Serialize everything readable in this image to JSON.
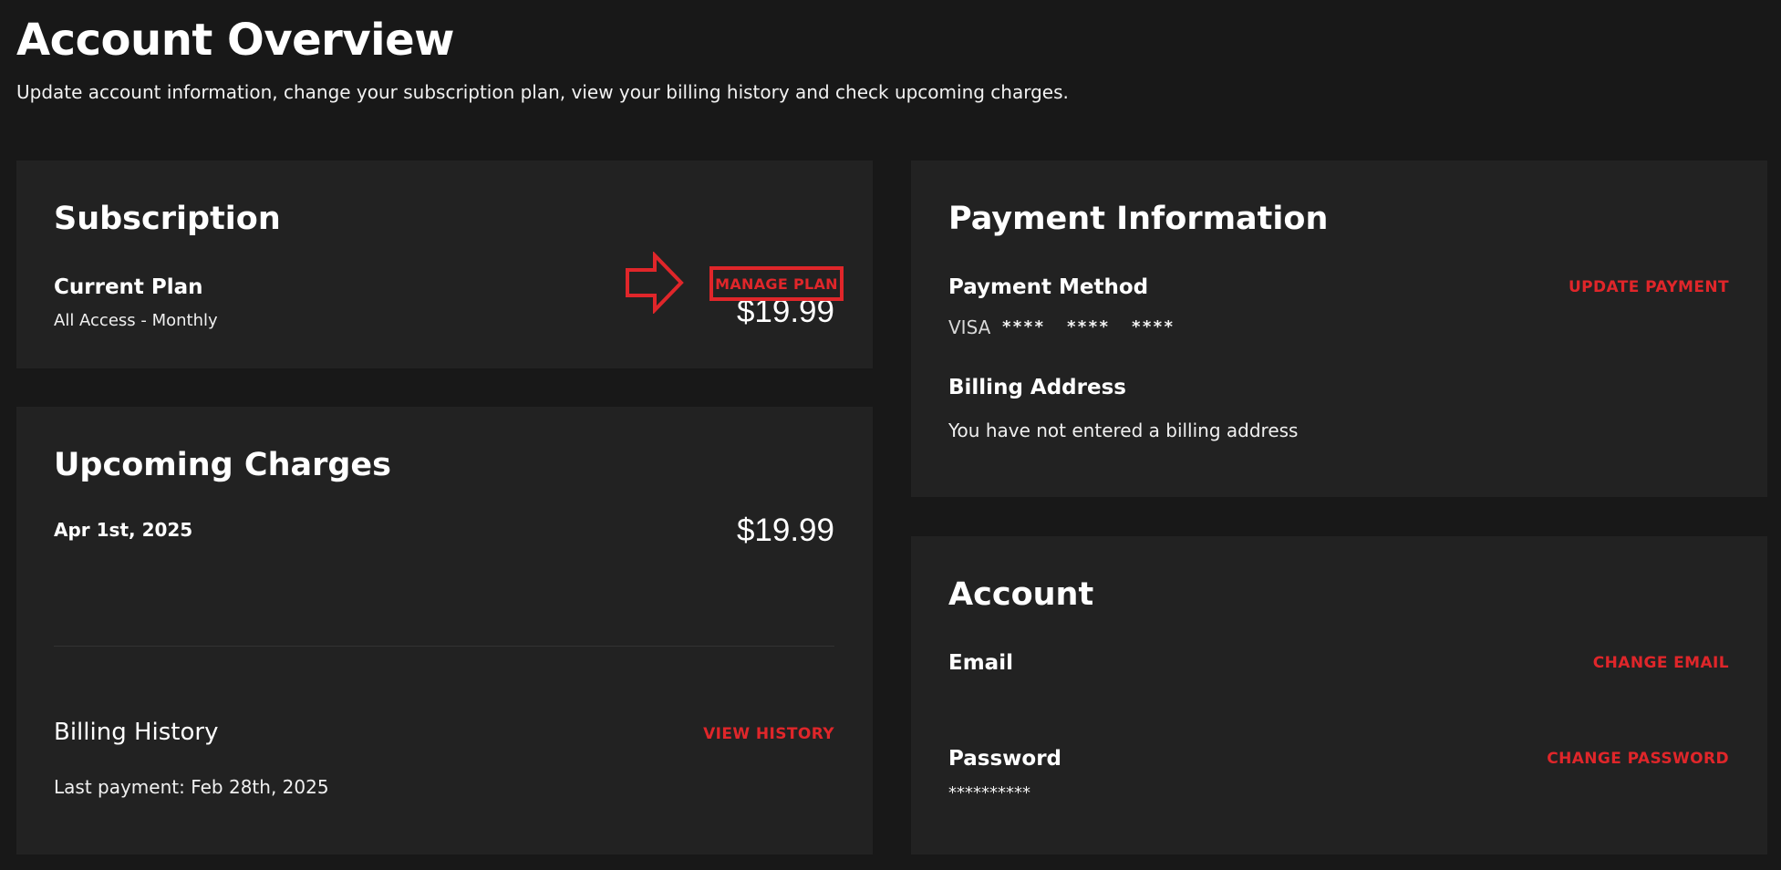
{
  "header": {
    "title": "Account Overview",
    "subtitle": "Update account information, change your subscription plan, view your billing history and check upcoming charges."
  },
  "subscription": {
    "title": "Subscription",
    "current_plan_label": "Current Plan",
    "plan_name": "All Access - Monthly",
    "price": "$19.99",
    "manage_plan_label": "MANAGE PLAN"
  },
  "upcoming": {
    "title": "Upcoming Charges",
    "date": "Apr 1st, 2025",
    "amount": "$19.99",
    "billing_history_label": "Billing History",
    "view_history_label": "VIEW HISTORY",
    "last_payment": "Last payment: Feb 28th, 2025"
  },
  "payment": {
    "title": "Payment Information",
    "method_label": "Payment Method",
    "update_label": "UPDATE PAYMENT",
    "card_brand": "VISA",
    "card_masked": "****  ****  ****",
    "billing_address_label": "Billing Address",
    "billing_address_value": "You have not entered a billing address"
  },
  "account": {
    "title": "Account",
    "email_label": "Email",
    "change_email_label": "CHANGE EMAIL",
    "password_label": "Password",
    "change_password_label": "CHANGE PASSWORD",
    "password_masked": "**********"
  },
  "colors": {
    "background": "#181818",
    "card": "#222222",
    "accent": "#e0262a",
    "text": "#ffffff"
  },
  "icons": {
    "annotation": "arrow-right-outline-icon"
  }
}
